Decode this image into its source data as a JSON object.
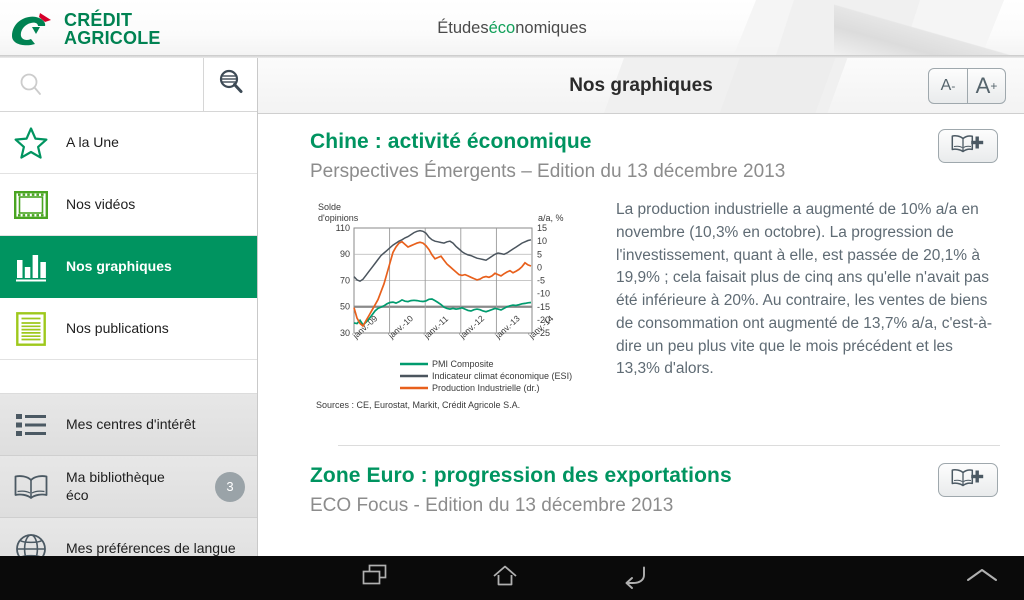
{
  "header": {
    "title_prefix": "Études ",
    "title_green": "éco",
    "title_suffix": "nomiques",
    "logo_line1": "CRÉDIT",
    "logo_line2": "AGRICOLE"
  },
  "sidebar": {
    "search_placeholder": "",
    "search_value": "",
    "search_icon": "search-icon",
    "advanced_search_icon": "advanced-search-icon",
    "items": [
      {
        "label": "A la Une",
        "icon": "star-icon",
        "active": false
      },
      {
        "label": "Nos vidéos",
        "icon": "film-icon",
        "active": false
      },
      {
        "label": "Nos graphiques",
        "icon": "bar-chart-icon",
        "active": true
      },
      {
        "label": "Nos publications",
        "icon": "document-icon",
        "active": false
      }
    ],
    "secondary_items": [
      {
        "label": "Mes centres d'intérêt",
        "icon": "list-icon",
        "badge": ""
      },
      {
        "label": "Ma bibliothèque",
        "label2": "éco",
        "icon": "book-icon",
        "badge": "3"
      },
      {
        "label": "Mes préférences de langue",
        "icon": "globe-icon",
        "badge": ""
      }
    ]
  },
  "main": {
    "title": "Nos graphiques",
    "font_decrease_label": "A",
    "font_decrease_sup": "-",
    "font_increase_label": "A",
    "font_increase_sup": "+",
    "add_icon": "book-plus-icon"
  },
  "articles": [
    {
      "title": "Chine : activité économique",
      "subtitle": "Perspectives Émergents – Edition du 13 décembre 2013",
      "body": "La production industrielle a augmenté de 10% a/a en novembre (10,3% en octobre). La progression de l'investissement, quant à elle, est passée de 20,1% à 19,9% ; cela faisait plus de cinq ans qu'elle n'avait pas été inférieure à 20%. Au contraire, les ventes de biens de consommation ont augmenté de 13,7% a/a, c'est-à-dire un peu plus vite que le mois précédent et les 13,3% d'alors.",
      "add_button_label": "book-plus-icon"
    },
    {
      "title": "Zone Euro : progression des exportations",
      "subtitle": "ECO Focus - Edition du 13 décembre 2013",
      "add_button_label": "book-plus-icon"
    }
  ],
  "chart_data": {
    "type": "line",
    "title": "",
    "ylabel_left": "Solde\nd'opinions",
    "ylabel_left_line1": "Solde",
    "ylabel_left_line2": "d'opinions",
    "ylabel_right": "a/a, %",
    "xlabel": "",
    "x_ticks": [
      "janv.-09",
      "janv.-10",
      "janv.-11",
      "janv.-12",
      "janv.-13",
      "janv.-14"
    ],
    "y_ticks_left": [
      110,
      90,
      70,
      50,
      30
    ],
    "y_ticks_right": [
      15,
      10,
      5,
      0,
      -5,
      -10,
      -15,
      -20,
      -25
    ],
    "ylim_left": [
      30,
      110
    ],
    "ylim_right": [
      -25,
      15
    ],
    "grid": true,
    "legend_position": "bottom",
    "source": "Sources : CE, Eurostat, Markit, Crédit Agricole S.A.",
    "series": [
      {
        "name": "PMI Composite",
        "color": "#009b6e",
        "axis": "left",
        "values": [
          38,
          37.5,
          40,
          36.5,
          38.5,
          41,
          44,
          47,
          49,
          50,
          51,
          52.5,
          53.5,
          53.8,
          53,
          54,
          55.5,
          54.5,
          54.2,
          55,
          55.2,
          55,
          54.5,
          54.3,
          54.8,
          56,
          56.2,
          55,
          53.5,
          52,
          50,
          49,
          48.5,
          49,
          48.5,
          48.8,
          49.5,
          48.5,
          47.5,
          47,
          48,
          48.5,
          48,
          47,
          46.5,
          47.2,
          48,
          47.5,
          46.8,
          47.5,
          48.8,
          50,
          50.5,
          50.2,
          50.8,
          51.5,
          51.8,
          51.5,
          52,
          52.2
        ]
      },
      {
        "name": "Indicateur climat économique (ESI)",
        "color": "#4b555e",
        "axis": "left",
        "values": [
          73,
          70.5,
          69.5,
          71,
          74,
          77,
          80,
          83,
          86,
          89,
          91,
          93,
          95,
          97,
          98.5,
          100,
          101,
          102.5,
          103.5,
          105,
          106.5,
          107.5,
          108,
          107.5,
          106,
          103,
          101,
          100,
          99.5,
          99,
          98.5,
          99.5,
          100,
          98.5,
          96,
          94,
          92,
          90.5,
          89.5,
          89,
          88,
          87,
          86.5,
          86,
          85.5,
          87,
          88.5,
          90,
          91,
          90.5,
          90,
          91,
          92.5,
          94,
          95.5,
          97,
          98.5,
          99.5,
          100.5,
          101
        ]
      },
      {
        "name": "Production Industrielle (dr.)",
        "color": "#e8601c",
        "axis": "right",
        "values": [
          -15,
          -19,
          -21,
          -22,
          -20,
          -18,
          -16,
          -14,
          -12,
          -9,
          -6,
          -2,
          2,
          6,
          8,
          9.5,
          10,
          9,
          8,
          8.5,
          9,
          9.5,
          9.8,
          9.5,
          8.5,
          7,
          5,
          3.5,
          4,
          4.5,
          3,
          1.5,
          0.5,
          -0.5,
          -1.5,
          -2.5,
          -2.8,
          -2.5,
          -3,
          -3.5,
          -4,
          -4.5,
          -4.2,
          -3.5,
          -3.2,
          -3.5,
          -3,
          -2,
          -2.5,
          -3,
          -2.2,
          -1.5,
          -1,
          -1.8,
          -1.2,
          -0.5,
          0.5,
          2,
          1.2,
          0.8
        ]
      }
    ]
  },
  "android_nav": {
    "recents_icon": "recents-icon",
    "home_icon": "home-icon",
    "back_icon": "back-icon",
    "expand_icon": "chevron-up-icon"
  }
}
